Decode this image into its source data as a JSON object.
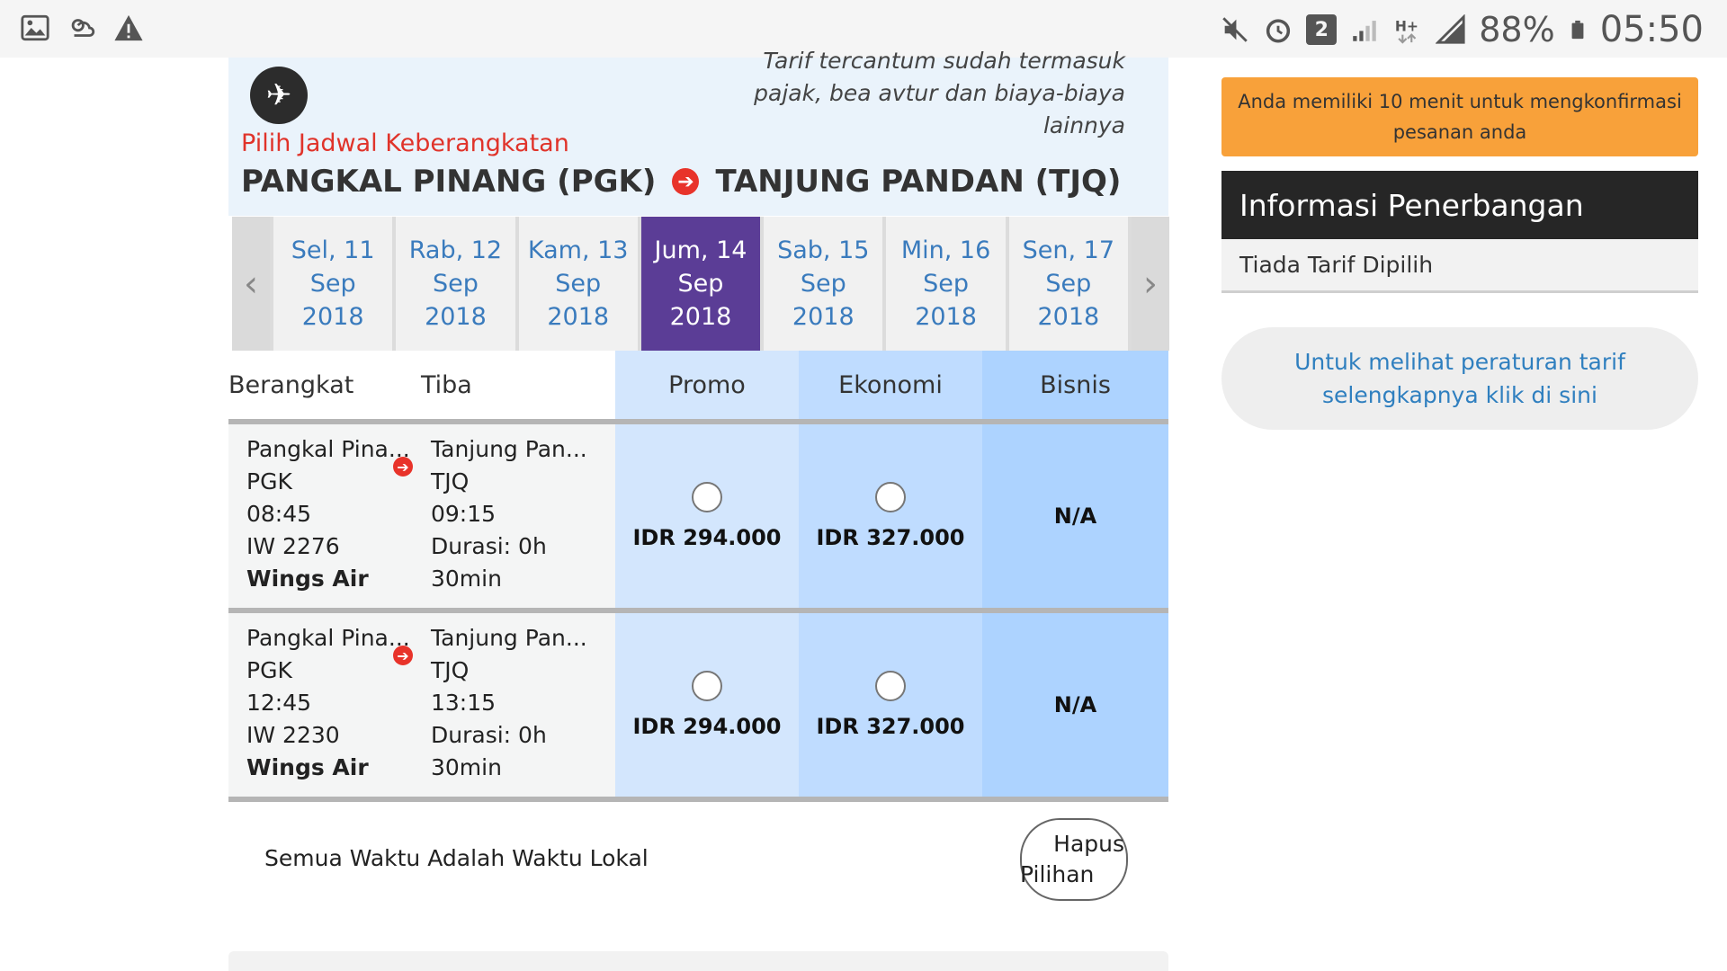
{
  "status_bar": {
    "left_icons": [
      "gallery-icon",
      "weather-icon",
      "warning-icon"
    ],
    "right_icons": [
      "mute-icon",
      "alarm-icon",
      "sim2-icon",
      "signal-icon",
      "hplus-icon",
      "signal-full-icon",
      "battery-icon"
    ],
    "sim_label": "2",
    "battery": "88%",
    "time": "05:50"
  },
  "header": {
    "note": "Tarif tercantum sudah termasuk pajak, bea avtur dan biaya-biaya lainnya",
    "choose_label": "Pilih Jadwal Keberangkatan",
    "origin": "PANGKAL PINANG (PGK)",
    "destination": "TANJUNG PANDAN (TJQ)"
  },
  "dates": [
    {
      "day": "Sel, 11",
      "month": "Sep",
      "year": "2018",
      "active": false
    },
    {
      "day": "Rab, 12",
      "month": "Sep",
      "year": "2018",
      "active": false
    },
    {
      "day": "Kam, 13",
      "month": "Sep",
      "year": "2018",
      "active": false
    },
    {
      "day": "Jum, 14",
      "month": "Sep",
      "year": "2018",
      "active": true
    },
    {
      "day": "Sab, 15",
      "month": "Sep",
      "year": "2018",
      "active": false
    },
    {
      "day": "Min, 16",
      "month": "Sep",
      "year": "2018",
      "active": false
    },
    {
      "day": "Sen, 17",
      "month": "Sep",
      "year": "2018",
      "active": false
    }
  ],
  "table": {
    "headers": {
      "depart": "Berangkat",
      "arrive": "Tiba",
      "promo": "Promo",
      "economy": "Ekonomi",
      "business": "Bisnis"
    },
    "flights": [
      {
        "origin_city": "Pangkal Pina...",
        "origin_code": "PGK",
        "dep_time": "08:45",
        "flight_no": "IW 2276",
        "airline": "Wings Air",
        "dest_city": "Tanjung Pan...",
        "dest_code": "TJQ",
        "arr_time": "09:15",
        "duration_1": "Durasi: 0h",
        "duration_2": "30min",
        "promo_price": "IDR 294.000",
        "economy_price": "IDR 327.000",
        "business": "N/A"
      },
      {
        "origin_city": "Pangkal Pina...",
        "origin_code": "PGK",
        "dep_time": "12:45",
        "flight_no": "IW 2230",
        "airline": "Wings Air",
        "dest_city": "Tanjung Pan...",
        "dest_code": "TJQ",
        "arr_time": "13:15",
        "duration_1": "Durasi: 0h",
        "duration_2": "30min",
        "promo_price": "IDR 294.000",
        "economy_price": "IDR 327.000",
        "business": "N/A"
      }
    ]
  },
  "footer": {
    "local_time_note": "Semua Waktu Adalah Waktu Lokal",
    "clear_line1": "Hapus",
    "clear_line2": "Pilihan"
  },
  "sidebar": {
    "timer_line1": "Anda memiliki 10 menit untuk mengkonfirmasi",
    "timer_line2": "pesanan anda",
    "info_title": "Informasi Penerbangan",
    "info_body": "Tiada Tarif Dipilih",
    "rules_line1": "Untuk melihat peraturan tarif",
    "rules_line2": "selengkapnya klik di sini"
  }
}
